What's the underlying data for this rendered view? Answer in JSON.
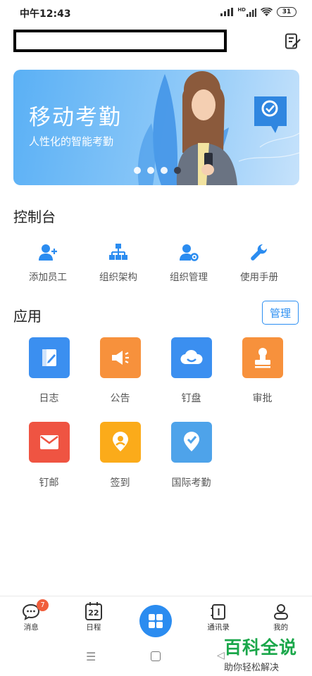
{
  "status_bar": {
    "time": "中午12:43",
    "network": "HD",
    "battery": "31"
  },
  "banner": {
    "title": "移动考勤",
    "subtitle": "人性化的智能考勤",
    "dots": 4,
    "active_dot": 3,
    "colors": {
      "bg_start": "#5ab0f5",
      "bg_end": "#c6e2fb"
    }
  },
  "console": {
    "title": "控制台",
    "items": [
      {
        "label": "添加员工",
        "icon": "add-user-icon"
      },
      {
        "label": "组织架构",
        "icon": "org-chart-icon"
      },
      {
        "label": "组织管理",
        "icon": "user-settings-icon"
      },
      {
        "label": "使用手册",
        "icon": "wrench-icon"
      }
    ]
  },
  "apps": {
    "title": "应用",
    "manage_label": "管理",
    "items": [
      {
        "label": "日志",
        "icon": "log-icon",
        "color": "#3b8ff0"
      },
      {
        "label": "公告",
        "icon": "megaphone-icon",
        "color": "#f7913c"
      },
      {
        "label": "钉盘",
        "icon": "cloud-icon",
        "color": "#3b8ff0"
      },
      {
        "label": "审批",
        "icon": "stamp-icon",
        "color": "#f7913c"
      },
      {
        "label": "钉邮",
        "icon": "mail-icon",
        "color": "#ef5442"
      },
      {
        "label": "签到",
        "icon": "location-pin-icon",
        "color": "#fbab1a"
      },
      {
        "label": "国际考勤",
        "icon": "location-check-icon",
        "color": "#4ea3ea"
      }
    ]
  },
  "tabbar": {
    "items": [
      {
        "label": "消息",
        "icon": "chat-icon",
        "badge": "7"
      },
      {
        "label": "日程",
        "icon": "calendar-icon",
        "day": "22"
      },
      {
        "label": "",
        "icon": "grid-icon"
      },
      {
        "label": "通讯录",
        "icon": "contacts-icon"
      },
      {
        "label": "我的",
        "icon": "profile-icon"
      }
    ],
    "accent": "#2b8cf0"
  },
  "navbar": {
    "menu_glyph": "☰",
    "back_glyph": "◁"
  },
  "watermark": {
    "title": "百科全说",
    "subtitle": "助你轻松解决"
  }
}
